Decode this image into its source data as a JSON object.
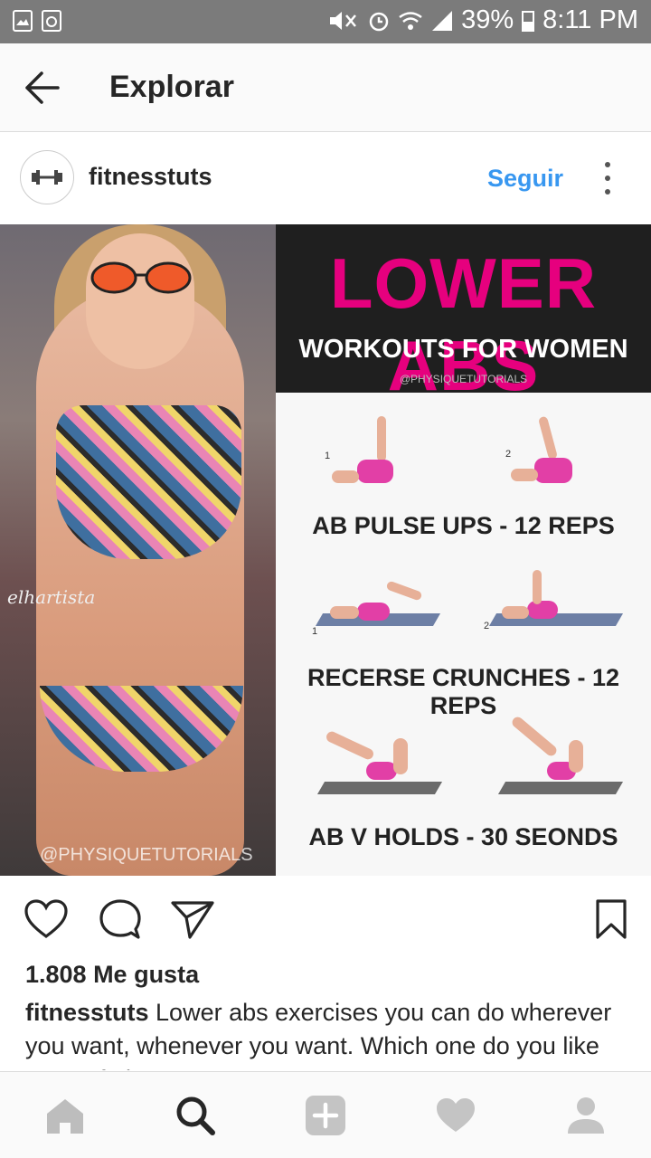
{
  "status_bar": {
    "battery": "39%",
    "time": "8:11 PM"
  },
  "header": {
    "title": "Explorar"
  },
  "post": {
    "username": "fitnesstuts",
    "follow_label": "Seguir",
    "likes": "1.808 Me gusta",
    "caption_user": "fitnesstuts",
    "caption_text": " Lower abs exercises you can do wherever you want, whenever you want. Which one do you like most of above?"
  },
  "image": {
    "signature": "elhartista",
    "photo_watermark": "@PHYSIQUETUTORIALS",
    "panel_title": "LOWER ABS",
    "panel_subtitle": "WORKOUTS FOR WOMEN",
    "panel_watermark": "@PHYSIQUETUTORIALS",
    "exercises": [
      {
        "label": "AB PULSE UPS  -  12 REPS",
        "step1": "1",
        "step2": "2"
      },
      {
        "label": "RECERSE CRUNCHES - 12 REPS",
        "step1": "1",
        "step2": "2"
      },
      {
        "label": "AB V HOLDS - 30 SEONDS"
      }
    ],
    "colors": {
      "title": "#e6007e",
      "figure": "#e23fa6"
    }
  },
  "nav": {
    "items": [
      "home-icon",
      "search-icon",
      "add-icon",
      "heart-icon",
      "profile-icon"
    ]
  },
  "colors": {
    "link": "#3897f0"
  }
}
